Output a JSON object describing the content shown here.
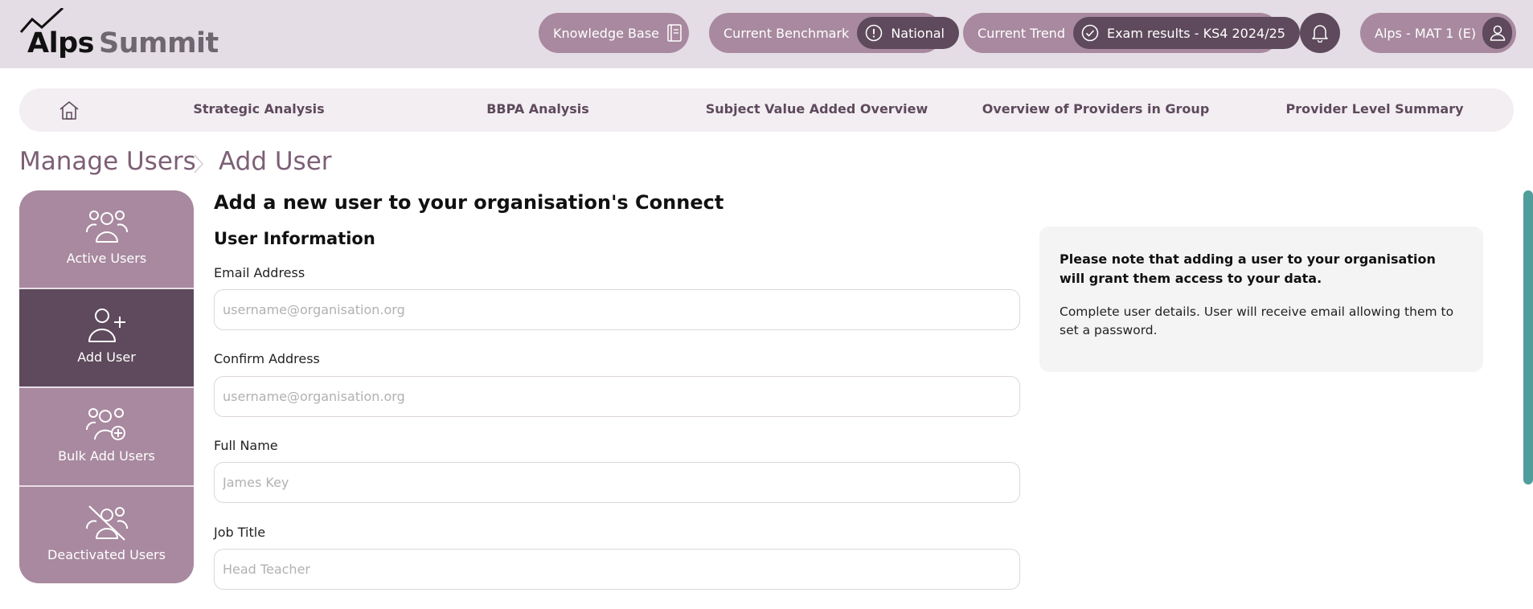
{
  "app": {
    "logo_primary": "Alps",
    "logo_secondary": "Summit"
  },
  "header": {
    "knowledge_base_label": "Knowledge Base",
    "benchmark_label": "Current Benchmark",
    "benchmark_value": "National",
    "trend_label": "Current Trend",
    "trend_value": "Exam results - KS4 2024/25",
    "user_label": "Alps - MAT 1 (E)"
  },
  "nav": {
    "items": [
      {
        "label": "Strategic Analysis"
      },
      {
        "label": "BBPA Analysis"
      },
      {
        "label": "Subject Value Added Overview"
      },
      {
        "label": "Overview of Providers in Group"
      },
      {
        "label": "Provider Level Summary"
      }
    ]
  },
  "breadcrumb": {
    "parent": "Manage Users",
    "current": "Add User"
  },
  "sidemenu": {
    "items": [
      {
        "label": "Active Users",
        "icon": "users-icon"
      },
      {
        "label": "Add User",
        "icon": "user-plus-icon",
        "active": true
      },
      {
        "label": "Bulk Add Users",
        "icon": "users-plus-icon"
      },
      {
        "label": "Deactivated Users",
        "icon": "users-off-icon"
      }
    ]
  },
  "form": {
    "title": "Add a new user to your organisation's Connect",
    "section": "User Information",
    "fields": [
      {
        "label": "Email Address",
        "placeholder": "username@organisation.org"
      },
      {
        "label": "Confirm Address",
        "placeholder": "username@organisation.org"
      },
      {
        "label": "Full Name",
        "placeholder": "James Key"
      },
      {
        "label": "Job Title",
        "placeholder": "Head Teacher"
      }
    ]
  },
  "notice": {
    "strong": "Please note that adding a user to your organisation will grant them access to your data.",
    "text": "Complete user details. User will receive email allowing them to set a password."
  },
  "colors": {
    "header_bg": "#e5dde5",
    "pill": "#a8899f",
    "pill_dark": "#5e4a5c",
    "accent_text": "#7d5f76",
    "scrollbar": "#4f9e9c"
  }
}
